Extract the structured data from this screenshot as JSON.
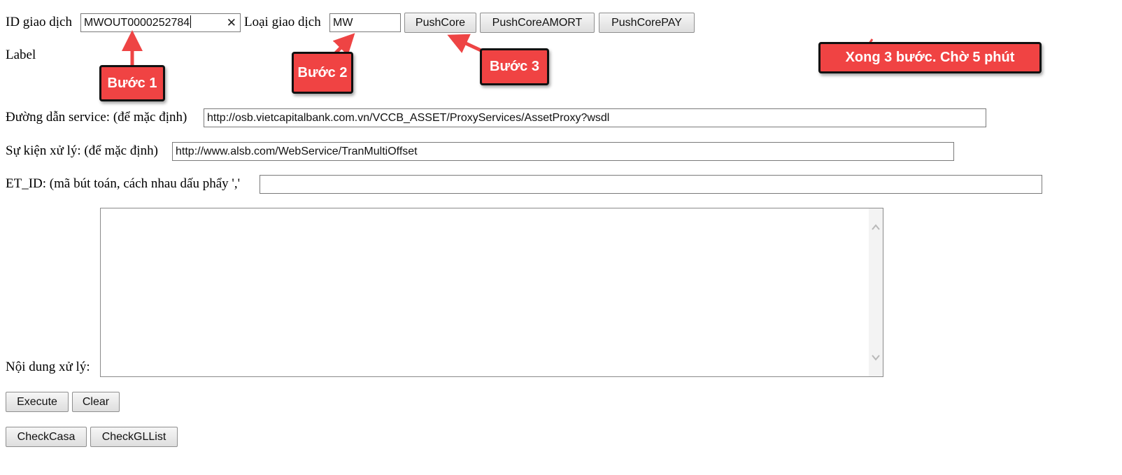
{
  "form": {
    "transaction_id_label": "ID giao dịch",
    "transaction_id_value": "MWOUT0000252784",
    "transaction_type_label": "Loại giao dịch",
    "transaction_type_value": "MW",
    "push_core_label": "PushCore",
    "push_core_amort_label": "PushCoreAMORT",
    "push_core_pay_label": "PushCorePAY",
    "status_label": "Label",
    "service_path_label": "Đường dẫn service: (để mặc định)",
    "service_path_value": "http://osb.vietcapitalbank.com.vn/VCCB_ASSET/ProxyServices/AssetProxy?wsdl",
    "event_label": "Sự kiện xử lý: (để mặc định)",
    "event_value": "http://www.alsb.com/WebService/TranMultiOffset",
    "et_id_label": "ET_ID: (mã bút toán, cách nhau dấu phẩy ','",
    "et_id_value": "",
    "content_label": "Nội dung xử lý:",
    "content_value": ""
  },
  "actions": {
    "execute_label": "Execute",
    "clear_label": "Clear",
    "check_casa_label": "CheckCasa",
    "check_gl_list_label": "CheckGLList"
  },
  "annotations": {
    "step1": "Bước 1",
    "step2": "Bước 2",
    "step3": "Bước 3",
    "done": "Xong 3 bước. Chờ 5 phút"
  },
  "colors": {
    "callout_fill": "#f04343",
    "callout_border": "#111111",
    "arrow": "#ee4444"
  },
  "icons": {
    "clear_input": "close-icon",
    "scroll_up": "chevron-up-icon",
    "scroll_down": "chevron-down-icon"
  }
}
